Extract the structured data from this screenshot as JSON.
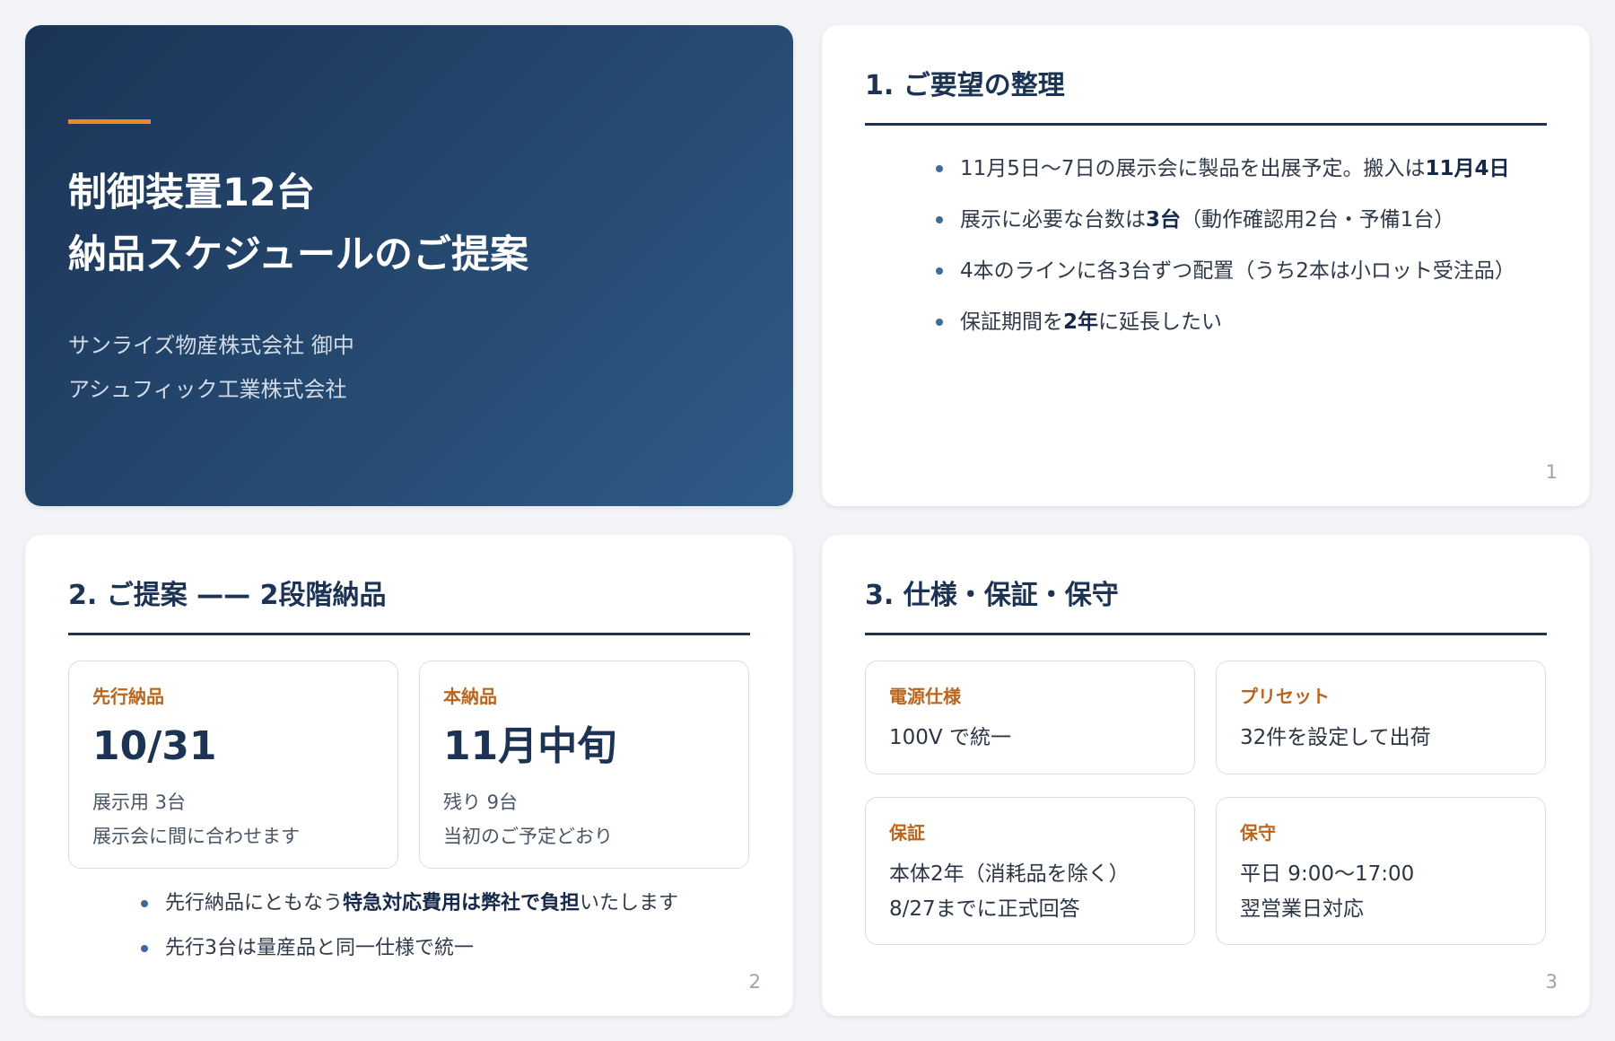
{
  "theme": {
    "navy": "#1d3354",
    "navy_dark": "#1b3456",
    "navy_light": "#2f5b87",
    "accent": "#e8892b",
    "label": "#b8661e",
    "bullet": "#3f6b98"
  },
  "title_slide": {
    "title_line1": "制御装置12台",
    "title_line2": "納品スケジュールのご提案",
    "recipient": "サンライズ物産株式会社 御中",
    "sender": "アシュフィック工業株式会社"
  },
  "slide1": {
    "heading": "1. ご要望の整理",
    "page": "1",
    "bullets": [
      {
        "text": "11月5日〜7日の展示会に製品を出展予定。搬入は",
        "strong": "11月4日"
      },
      {
        "text": "展示に必要な台数は",
        "strong": "3台",
        "rest": "（動作確認用2台・予備1台）"
      },
      {
        "text": "4本のラインに各3台ずつ配置（うち2本は小ロット受注品）"
      },
      {
        "text": "保証期間を",
        "strong": "2年",
        "rest": "に延長したい"
      }
    ]
  },
  "slide2": {
    "heading": "2. ご提案 —— 2段階納品",
    "page": "2",
    "cards": [
      {
        "label": "先行納品",
        "value": "10/31",
        "lines": [
          "展示用 3台",
          "展示会に間に合わせます"
        ]
      },
      {
        "label": "本納品",
        "value": "11月中旬",
        "lines": [
          "残り 9台",
          "当初のご予定どおり"
        ]
      }
    ],
    "bullets": [
      {
        "text": "先行納品にともなう",
        "strong": "特急対応費用は弊社で負担",
        "rest": "いたします"
      },
      {
        "text": "先行3台は量産品と同一仕様で統一"
      }
    ]
  },
  "slide3": {
    "heading": "3. 仕様・保証・保守",
    "page": "3",
    "cards": [
      {
        "label": "電源仕様",
        "lines": [
          "100V で統一"
        ]
      },
      {
        "label": "プリセット",
        "lines": [
          "32件を設定して出荷"
        ]
      },
      {
        "label": "保証",
        "lines": [
          "本体2年（消耗品を除く）",
          "8/27までに正式回答"
        ]
      },
      {
        "label": "保守",
        "lines": [
          "平日 9:00〜17:00",
          "翌営業日対応"
        ]
      }
    ]
  }
}
